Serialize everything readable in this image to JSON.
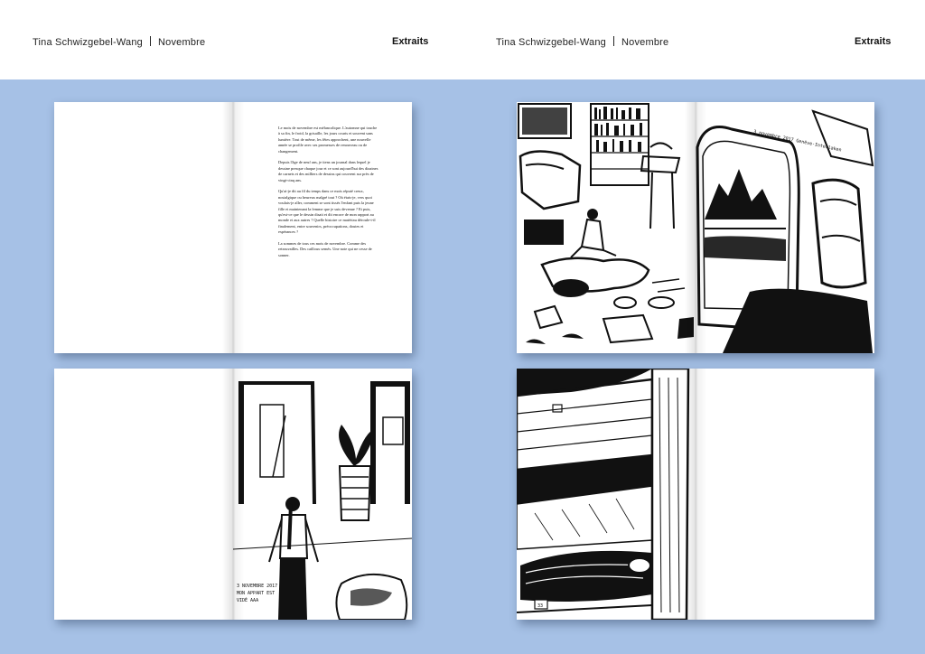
{
  "header": {
    "left": {
      "author": "Tina Schwizgebel-Wang",
      "title": "Novembre",
      "section": "Extraits"
    },
    "right": {
      "author": "Tina Schwizgebel-Wang",
      "title": "Novembre",
      "section": "Extraits"
    }
  },
  "colors": {
    "background": "#a6c1e6",
    "page": "#ffffff",
    "ink": "#111111"
  },
  "text_page": {
    "paragraphs": [
      "Le mois de novembre est mélancolique. L'automne qui touche à sa fin, le froid, la grisaille, les jours courts et souvent sans lumière. Tout de même, les fêtes approchent, une nouvelle année se profile avec ses promesses de renouveau ou de changement.",
      "Depuis l'âge de neuf ans, je tiens un journal dans lequel je dessine presque chaque jour et ce sont aujourd'hui des dizaines de carnets et des milliers de dessins qui couvrent sur près de vingt-cinq ans.",
      "Qu'ai-je dit au fil du temps dans ce mois réputé creux, nostalgique ou heureux malgré tout ? Où étais-je, vers quoi voulais-je aller, comment se sont tissés l'enfant puis la jeune fille et maintenant la femme que je suis devenue ? Et puis, qu'est-ce que le dessin disait et dit encore de mon rapport au monde et aux autres ? Quelle histoire ce matériau déroule-t-il finalement, entre souvenirs, préoccupations, doutes et espérances ?",
      "La sommes de tous ces mois de novembre. Comme des retrouvailles. Des cailloux semés. Une note qui ne cesse de sonner."
    ]
  },
  "handwritten": {
    "train_page": "3 novembre 2017 Genève-Interlaken",
    "girl_page": [
      "3 NOVEMBRE 2017",
      "MON APPART EST",
      "VIDÉ AAA"
    ],
    "bunk_page": "33"
  }
}
